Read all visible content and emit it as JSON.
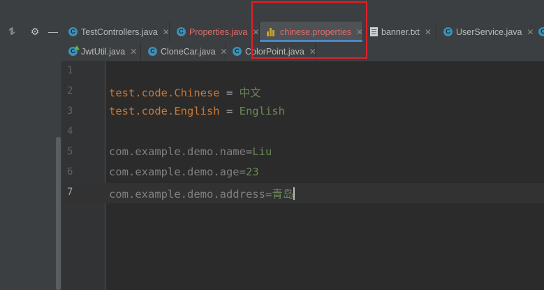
{
  "tabs_row1": [
    {
      "label": "TestControllers.java",
      "icon": "java-class-icon",
      "modified": false
    },
    {
      "label": "Properties.java",
      "icon": "java-class-icon",
      "modified": true
    },
    {
      "label": "chinese.properties",
      "icon": "properties-file-icon",
      "modified": true,
      "active": true
    },
    {
      "label": "banner.txt",
      "icon": "text-file-icon",
      "modified": false
    },
    {
      "label": "UserService.java",
      "icon": "java-class-icon",
      "modified": false
    }
  ],
  "tabs_row2": [
    {
      "label": "JwtUtil.java",
      "icon": "java-class-icon"
    },
    {
      "label": "CloneCar.java",
      "icon": "java-class-icon"
    },
    {
      "label": "ColorPoint.java",
      "icon": "java-class-icon"
    }
  ],
  "editor": {
    "current_line": 7,
    "lines": [
      {
        "num": "1",
        "key": "",
        "sep": "",
        "value": ""
      },
      {
        "num": "2",
        "key": "test.code.Chinese",
        "sep": " = ",
        "value": "中文"
      },
      {
        "num": "3",
        "key": "test.code.English",
        "sep": " = ",
        "value": "English"
      },
      {
        "num": "4",
        "key": "",
        "sep": "",
        "value": ""
      },
      {
        "num": "5",
        "key": "com.example.demo.name",
        "sep": "=",
        "value": "Liu"
      },
      {
        "num": "6",
        "key": "com.example.demo.age",
        "sep": "=",
        "value": "23"
      },
      {
        "num": "7",
        "key": "com.example.demo.address",
        "sep": "=",
        "value": "青岛"
      }
    ]
  },
  "colors": {
    "accent_tab": "#4a88c7",
    "annotation_box": "#e0202a",
    "property_key": "#cc7832",
    "property_value": "#6a8759"
  }
}
